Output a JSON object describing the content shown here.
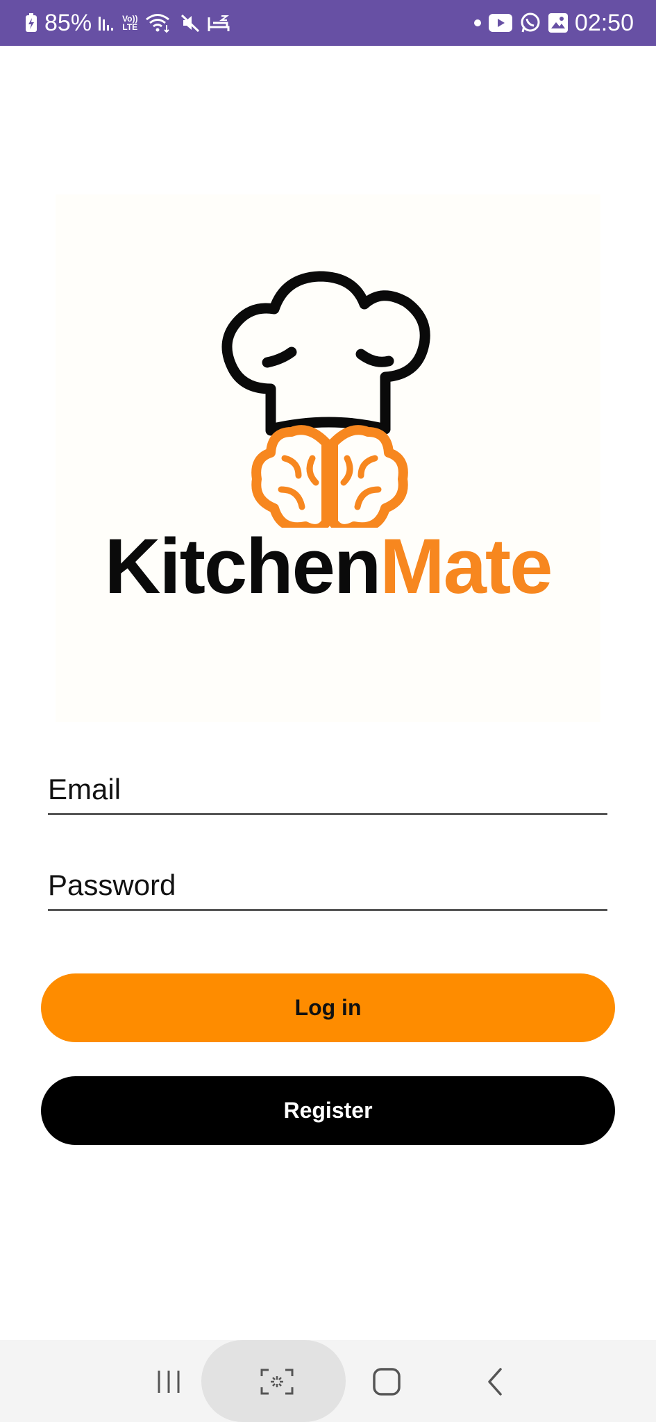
{
  "status_bar": {
    "battery_percent": "85%",
    "time": "02:50",
    "background": "#6750a4",
    "left_icons": [
      "battery-charging-icon",
      "signal-icon",
      "volte-icon",
      "wifi-icon",
      "mute-icon",
      "sleep-icon"
    ],
    "right_icons": [
      "dot-icon",
      "youtube-icon",
      "whatsapp-icon",
      "gallery-icon"
    ],
    "volte_label_top": "Vo))",
    "volte_label_bottom": "LTE"
  },
  "logo": {
    "word_part1": "Kitchen",
    "word_part2": "Mate",
    "color_dark": "#0a0a0a",
    "color_accent": "#f7871f",
    "icons": [
      "chef-hat-icon",
      "brain-icon"
    ]
  },
  "form": {
    "email": {
      "placeholder": "Email",
      "value": ""
    },
    "password": {
      "placeholder": "Password",
      "value": ""
    }
  },
  "buttons": {
    "login_label": "Log in",
    "login_color": "#fe8c00",
    "register_label": "Register",
    "register_color": "#000000"
  },
  "nav_bar": {
    "items": [
      "recents-icon",
      "capture-icon",
      "home-icon",
      "back-icon"
    ]
  }
}
